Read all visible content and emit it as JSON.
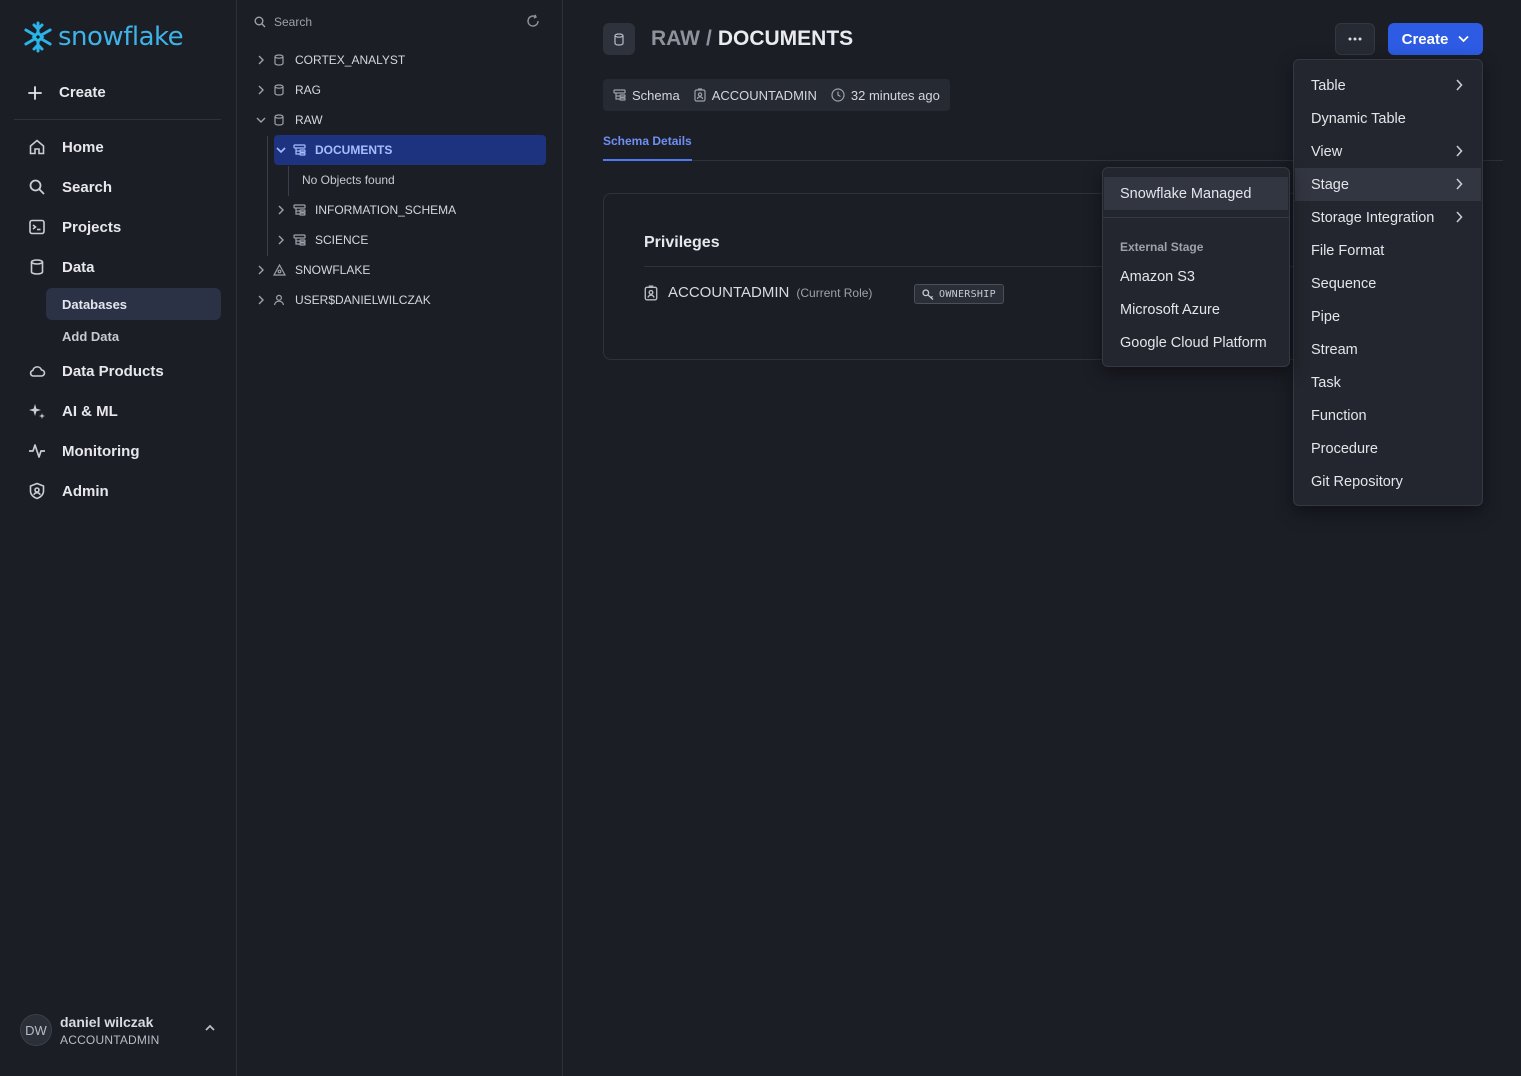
{
  "app": {
    "logo_text": "snowflake",
    "brand_color": "#29B5E8",
    "accent_color": "#2D5BE3"
  },
  "nav": {
    "create_label": "Create",
    "items": [
      {
        "label": "Home",
        "icon": "home-icon"
      },
      {
        "label": "Search",
        "icon": "search-icon"
      },
      {
        "label": "Projects",
        "icon": "terminal-icon"
      },
      {
        "label": "Data",
        "icon": "database-icon"
      },
      {
        "label": "Data Products",
        "icon": "cloud-icon"
      },
      {
        "label": "AI & ML",
        "icon": "sparkle-icon"
      },
      {
        "label": "Monitoring",
        "icon": "activity-icon"
      },
      {
        "label": "Admin",
        "icon": "shield-icon"
      }
    ],
    "data_sub": [
      {
        "label": "Databases",
        "active": true
      },
      {
        "label": "Add Data",
        "active": false
      }
    ]
  },
  "user": {
    "initials": "DW",
    "name": "daniel wilczak",
    "role": "ACCOUNTADMIN"
  },
  "explorer": {
    "search_placeholder": "Search",
    "nodes": [
      {
        "label": "CORTEX_ANALYST",
        "type": "database",
        "expanded": false
      },
      {
        "label": "RAG",
        "type": "database",
        "expanded": false
      },
      {
        "label": "RAW",
        "type": "database",
        "expanded": true
      },
      {
        "label": "DOCUMENTS",
        "type": "schema",
        "expanded": true,
        "selected": true
      },
      {
        "label": "No Objects found",
        "type": "empty"
      },
      {
        "label": "INFORMATION_SCHEMA",
        "type": "schema",
        "expanded": false
      },
      {
        "label": "SCIENCE",
        "type": "schema",
        "expanded": false
      },
      {
        "label": "SNOWFLAKE",
        "type": "shared-database",
        "expanded": false
      },
      {
        "label": "USER$DANIELWILCZAK",
        "type": "user",
        "expanded": false
      }
    ]
  },
  "header": {
    "parent": "RAW",
    "separator": "/",
    "current": "DOCUMENTS",
    "create_button": "Create"
  },
  "meta": {
    "type": "Schema",
    "owner": "ACCOUNTADMIN",
    "updated": "32 minutes ago"
  },
  "tabs": [
    "Schema Details"
  ],
  "privileges": {
    "title": "Privileges",
    "role": "ACCOUNTADMIN",
    "role_note": "(Current Role)",
    "badge": "OWNERSHIP"
  },
  "create_menu": {
    "items": [
      {
        "label": "Table",
        "submenu": true
      },
      {
        "label": "Dynamic Table",
        "submenu": false
      },
      {
        "label": "View",
        "submenu": true
      },
      {
        "label": "Stage",
        "submenu": true,
        "hover": true
      },
      {
        "label": "Storage Integration",
        "submenu": true
      },
      {
        "label": "File Format",
        "submenu": false
      },
      {
        "label": "Sequence",
        "submenu": false
      },
      {
        "label": "Pipe",
        "submenu": false
      },
      {
        "label": "Stream",
        "submenu": false
      },
      {
        "label": "Task",
        "submenu": false
      },
      {
        "label": "Function",
        "submenu": false
      },
      {
        "label": "Procedure",
        "submenu": false
      },
      {
        "label": "Git Repository",
        "submenu": false
      }
    ]
  },
  "stage_menu": {
    "internal": "Snowflake Managed",
    "external_heading": "External Stage",
    "external": [
      "Amazon S3",
      "Microsoft Azure",
      "Google Cloud Platform"
    ]
  }
}
